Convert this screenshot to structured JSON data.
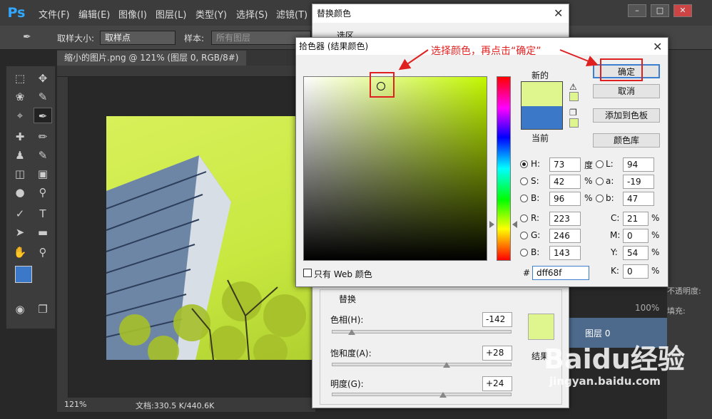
{
  "ps": {
    "logo": "Ps",
    "menu": [
      "文件(F)",
      "编辑(E)",
      "图像(I)",
      "图层(L)",
      "类型(Y)",
      "选择(S)",
      "滤镜(T)"
    ],
    "options": {
      "sample_size_label": "取样大小:",
      "sample_size_value": "取样点",
      "sample_label": "样本:",
      "sample_value": "所有图层"
    },
    "doc_tab": "缩小的图片.png @ 121% (图层 0, RGB/8#)",
    "status": {
      "zoom": "121%",
      "doc": "文档:330.5 K/440.6K"
    },
    "layers": {
      "opacity_label": "不透明度:",
      "fill_label": "填充:",
      "fill_value": "100%",
      "opacity_value": "100%",
      "layer_name": "图层 0"
    }
  },
  "replace_dialog": {
    "title": "替换颜色",
    "selection_label": "选区",
    "replace_group_label": "替换",
    "hue_label": "色相(H):",
    "hue_value": "-142",
    "hue_fraction": 0.11,
    "saturation_label": "饱和度(A):",
    "saturation_value": "+28",
    "saturation_fraction": 0.64,
    "lightness_label": "明度(G):",
    "lightness_value": "+24",
    "lightness_fraction": 0.62,
    "result_label": "结果",
    "result_color": "#dff68f"
  },
  "color_picker": {
    "title": "拾色器 (结果颜色)",
    "new_label": "新的",
    "current_label": "当前",
    "new_color": "#dff68f",
    "current_color": "#3c78c8",
    "buttons": {
      "ok": "确定",
      "cancel": "取消",
      "add_swatch": "添加到色板",
      "color_libraries": "颜色库"
    },
    "hsb": {
      "h_label": "H:",
      "h": "73",
      "h_unit": "度",
      "s_label": "S:",
      "s": "42",
      "s_unit": "%",
      "b_label": "B:",
      "b": "96",
      "b_unit": "%"
    },
    "rgb": {
      "r_label": "R:",
      "r": "223",
      "g_label": "G:",
      "g": "246",
      "b_label": "B:",
      "b": "143"
    },
    "lab": {
      "l_label": "L:",
      "l": "94",
      "a_label": "a:",
      "a": "-19",
      "b_label": "b:",
      "b": "47"
    },
    "cmyk": {
      "c_label": "C:",
      "c": "21",
      "m_label": "M:",
      "m": "0",
      "y_label": "Y:",
      "y": "54",
      "k_label": "K:",
      "k": "0",
      "unit": "%"
    },
    "hex_label": "#",
    "hex": "dff68f",
    "web_only_label": "只有 Web 颜色"
  },
  "annotation": "选择颜色，再点击“确定”",
  "watermark": {
    "brand": "Baidu经验",
    "url": "jingyan.baidu.com"
  }
}
